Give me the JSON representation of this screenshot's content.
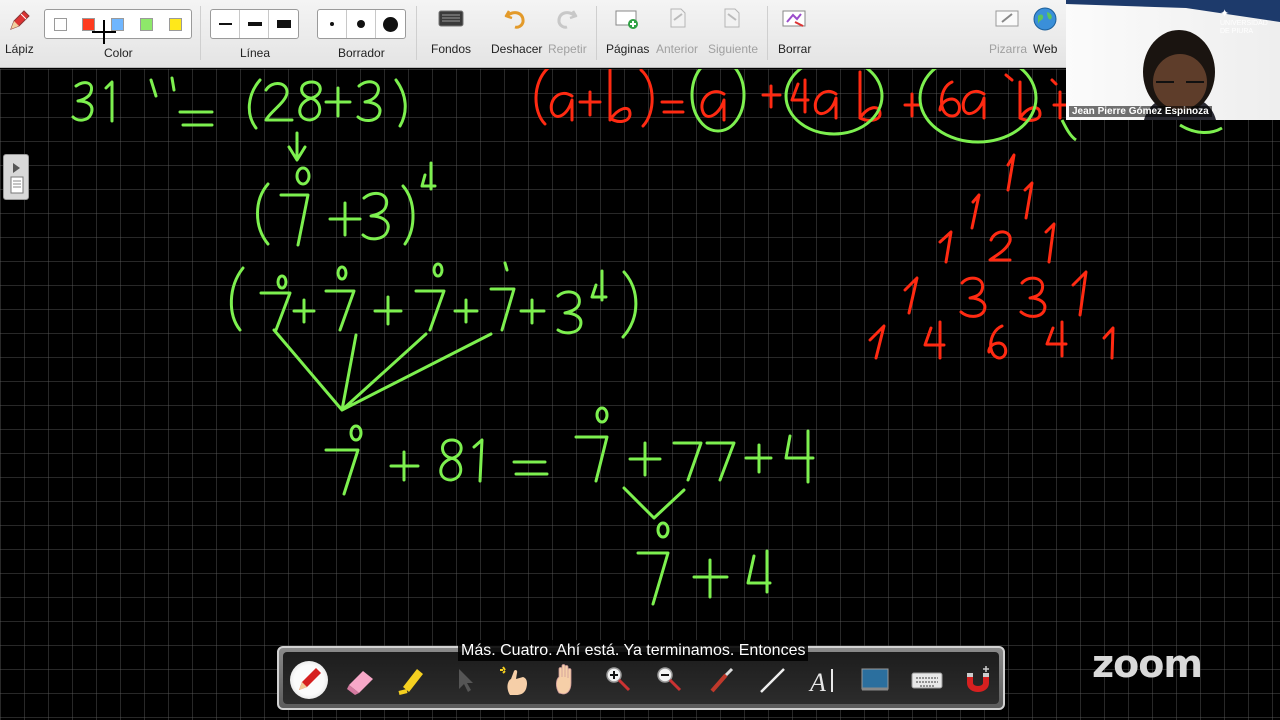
{
  "toolbar": {
    "pencil_label": "Lápiz",
    "color_label": "Color",
    "line_label": "Línea",
    "eraser_label": "Borrador",
    "backgrounds_label": "Fondos",
    "undo_label": "Deshacer",
    "redo_label": "Repetir",
    "pages_label": "Páginas",
    "previous_label": "Anterior",
    "next_label": "Siguiente",
    "clear_label": "Borrar",
    "whiteboard_label": "Pizarra",
    "web_label": "Web",
    "colors": [
      "#ffffff",
      "#ff3b1f",
      "#6fb6ff",
      "#8ee86a",
      "#ffe81a"
    ]
  },
  "webcam": {
    "participant_name": "Jean Pierre Gómez Espinoza",
    "university_logo": "UNIVERSIDAD DE PIURA"
  },
  "board": {
    "green_color": "#7df04f",
    "red_color": "#ff2a12",
    "grid_color": "#5f5f5f",
    "lines": {
      "l1": "31 = (28+3)",
      "l2": "(7+3)",
      "l2_exp": "4",
      "l3": "(7+7+7+7+3",
      "l3_exp": "4",
      "l4": "7+81 = 7+77+4",
      "l5": "7+4",
      "binomial": "(a+b) = a + 4a b + 6a b +",
      "pascal": [
        "1",
        "1  1",
        "1  2  1",
        "1  3  3  1",
        "1  4  6  4  1"
      ]
    }
  },
  "bottom_toolbar": {
    "tools": [
      "pen-icon",
      "eraser-icon",
      "highlighter-icon",
      "select-icon",
      "laser-hand-icon",
      "hand-icon",
      "zoom-in-icon",
      "zoom-out-icon",
      "brush-icon",
      "line-icon",
      "text-icon",
      "board-icon",
      "keyboard-icon",
      "magnet-icon"
    ]
  },
  "caption": "Más. Cuatro. Ahí está. Ya terminamos. Entonces",
  "zoom_logo": "zoom"
}
